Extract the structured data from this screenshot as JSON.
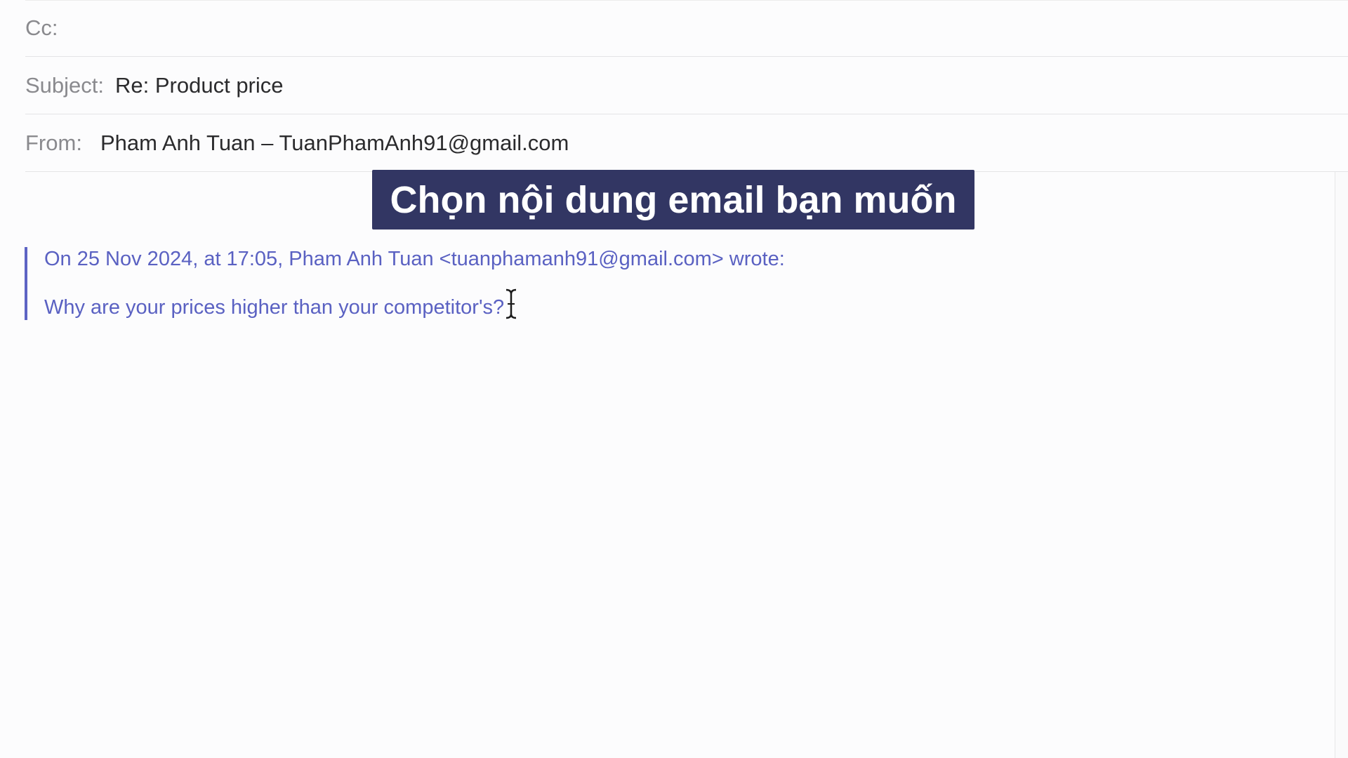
{
  "header": {
    "cc": {
      "label": "Cc:",
      "value": ""
    },
    "subject": {
      "label": "Subject:",
      "value": "Re: Product price"
    },
    "from": {
      "label": "From:",
      "value": "Pham Anh Tuan – TuanPhamAnh91@gmail.com"
    }
  },
  "overlay": {
    "caption": "Chọn nội dung email bạn muốn"
  },
  "quoted": {
    "attribution": "On 25 Nov 2024, at 17:05, Pham Anh Tuan <tuanphamanh91@gmail.com> wrote:",
    "message": "Why are your prices higher than your competitor's?"
  },
  "colors": {
    "quote_text": "#5a61c2",
    "quote_bar": "#5d64c4",
    "caption_bg": "#323663",
    "label": "#8a8a8e"
  },
  "icons": {
    "cursor": "text-cursor-icon"
  }
}
